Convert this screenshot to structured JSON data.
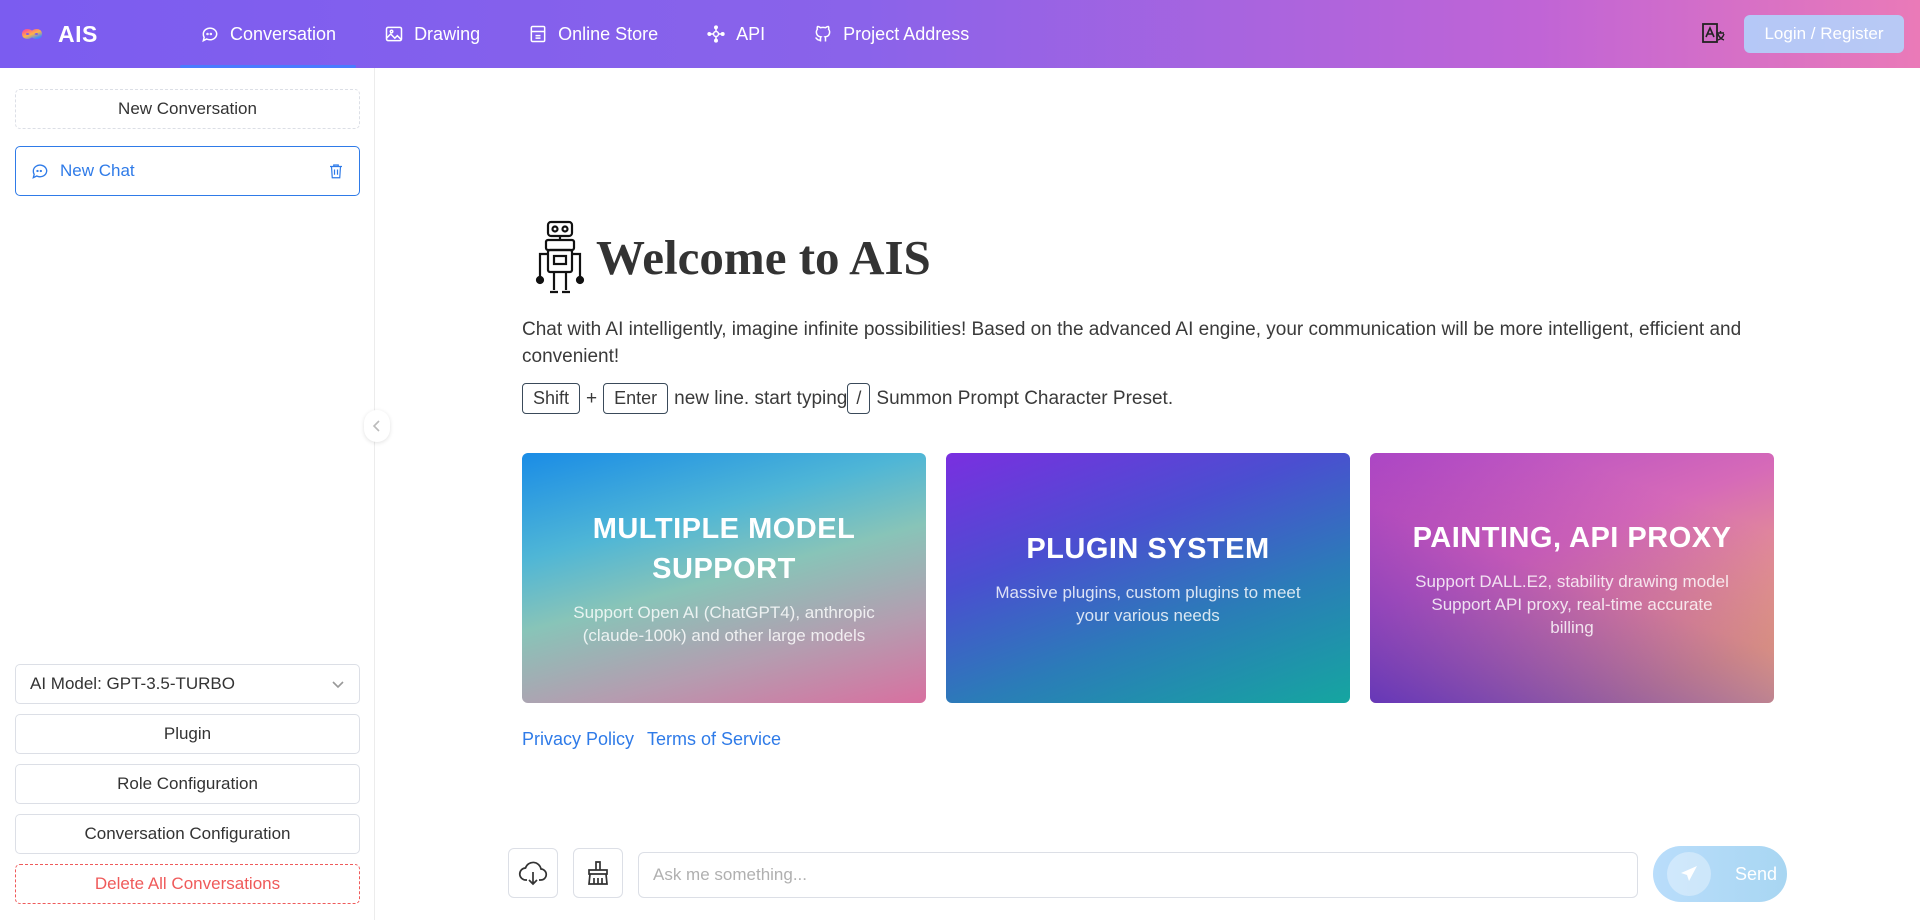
{
  "header": {
    "app_name": "AIS",
    "nav": [
      {
        "label": "Conversation",
        "icon": "chat-icon",
        "active": true
      },
      {
        "label": "Drawing",
        "icon": "image-icon"
      },
      {
        "label": "Online Store",
        "icon": "store-icon"
      },
      {
        "label": "API",
        "icon": "api-icon"
      },
      {
        "label": "Project Address",
        "icon": "github-icon"
      }
    ],
    "login_label": "Login / Register",
    "colors": {
      "gradient_start": "#7b5cf0",
      "gradient_end": "#ea7ab8",
      "active_underline": "#4a7bff"
    }
  },
  "sidebar": {
    "new_conversation": "New Conversation",
    "chats": [
      {
        "label": "New Chat"
      }
    ],
    "model_select": "AI Model: GPT-3.5-TURBO",
    "plugin": "Plugin",
    "role_config": "Role Configuration",
    "conversation_config": "Conversation Configuration",
    "delete_all": "Delete All Conversations",
    "colors": {
      "accent": "#2f7be8",
      "danger": "#ef5a5a"
    }
  },
  "main": {
    "welcome_title": "Welcome to AIS",
    "intro": "Chat with AI intelligently, imagine infinite possibilities! Based on the advanced AI engine, your communication will be more intelligent, efficient and convenient!",
    "hint": {
      "key1": "Shift",
      "plus": "+",
      "key2": "Enter",
      "text1": "new line. start typing",
      "key3": "/",
      "text2": "Summon Prompt Character Preset."
    },
    "cards": [
      {
        "title": "MULTIPLE MODEL SUPPORT",
        "desc": "Support Open AI (ChatGPT4), anthropic (claude-100k) and other large models"
      },
      {
        "title": "PLUGIN SYSTEM",
        "desc": "Massive plugins, custom plugins to meet your various needs"
      },
      {
        "title": "PAINTING, API PROXY",
        "desc_lines": [
          "Support DALL.E2, stability drawing model",
          "Support API proxy, real-time accurate billing"
        ]
      }
    ],
    "links": {
      "privacy": "Privacy Policy",
      "terms": "Terms of Service"
    },
    "input": {
      "placeholder": "Ask me something...",
      "send_label": "Send"
    }
  }
}
